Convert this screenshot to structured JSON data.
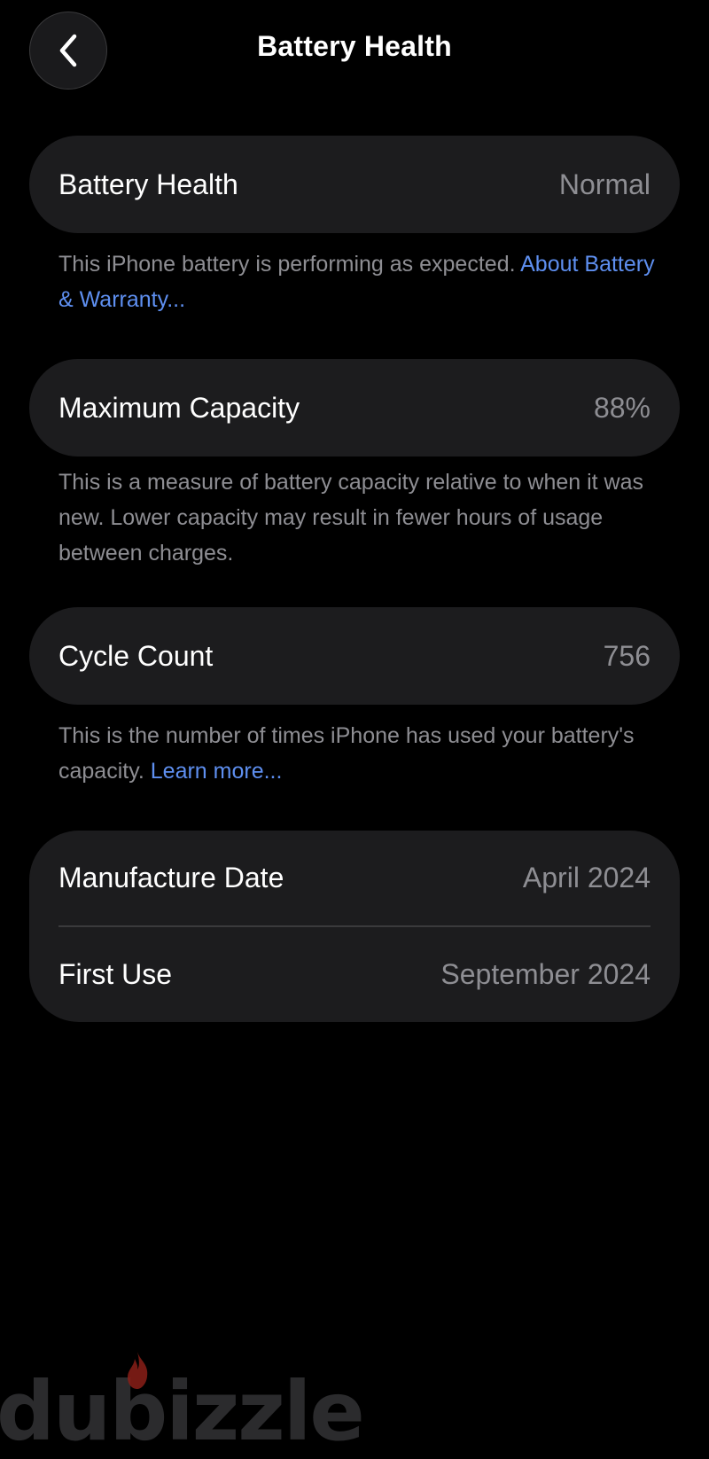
{
  "header": {
    "title": "Battery Health",
    "back_icon": "chevron-left-icon"
  },
  "sections": {
    "battery_health": {
      "label": "Battery Health",
      "value": "Normal",
      "footnote": "This iPhone battery is performing as expected.",
      "link": "About Battery & Warranty..."
    },
    "maximum_capacity": {
      "label": "Maximum Capacity",
      "value": "88%",
      "footnote": "This is a measure of battery capacity relative to when it was new. Lower capacity may result in fewer hours of usage between charges."
    },
    "cycle_count": {
      "label": "Cycle Count",
      "value": "756",
      "footnote": "This is the number of times iPhone has used your battery's capacity.",
      "link": "Learn more..."
    },
    "dates": {
      "manufacture_label": "Manufacture Date",
      "manufacture_value": "April 2024",
      "first_use_label": "First Use",
      "first_use_value": "September 2024"
    }
  },
  "watermark": {
    "text": "dubizzle"
  },
  "colors": {
    "background": "#000000",
    "card": "#1c1c1e",
    "secondary_text": "#8e8e93",
    "link": "#5e8ff0",
    "flame": "#c0392b"
  }
}
